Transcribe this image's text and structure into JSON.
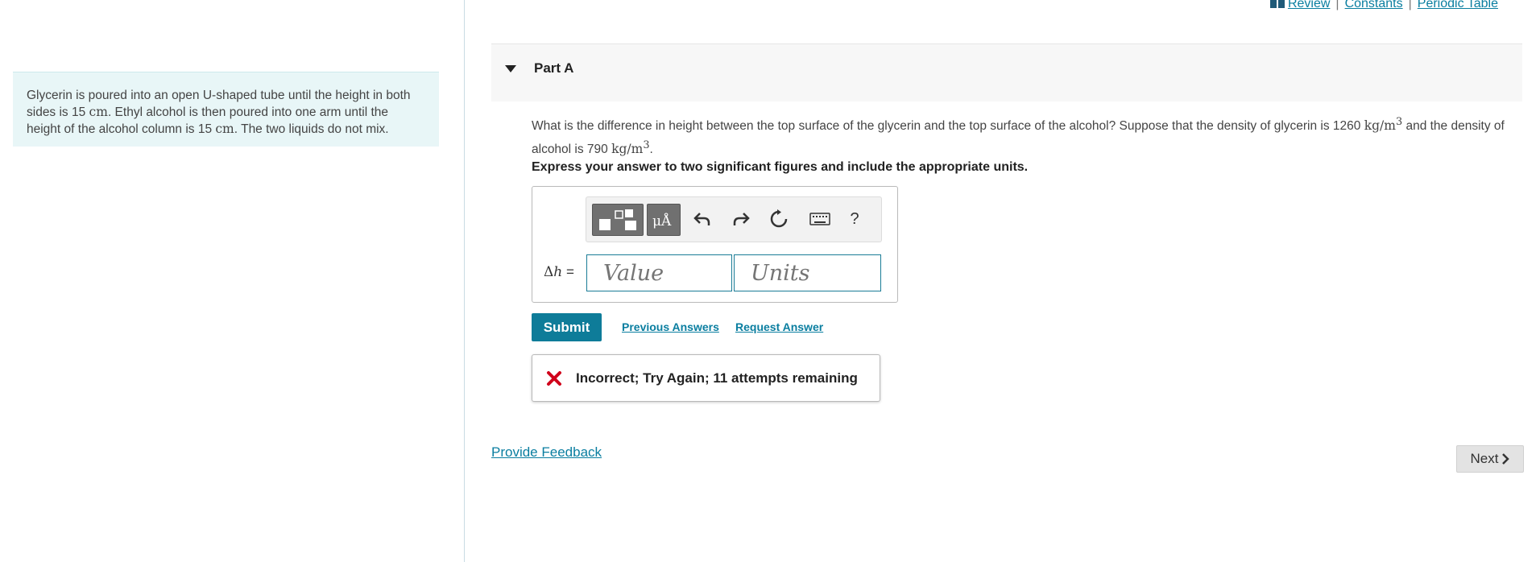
{
  "intro": {
    "t1": "Glycerin is poured into an open U-shaped tube until the height in both sides is 15 ",
    "u1": "cm",
    "t2": ". Ethyl alcohol is then poured into one arm until the height of the alcohol column is 15 ",
    "u2": "cm",
    "t3": ". The two liquids do not mix."
  },
  "toplinks": {
    "review": "Review",
    "constants": "Constants",
    "periodic": "Periodic Table",
    "sep": "|"
  },
  "part": {
    "title": "Part A"
  },
  "question": {
    "t1": "What is the difference in height between the top surface of the glycerin and the top surface of the alcohol? Suppose that the density of glycerin is 1260 ",
    "unit": "kg/m",
    "exp": "3",
    "t2": " and the density of alcohol is 790 ",
    "t3": "."
  },
  "instruction": "Express your answer to two significant figures and include the appropriate units.",
  "toolbar": {
    "units_glyph": "μÅ",
    "help": "?"
  },
  "answer": {
    "label_sym": "Δ",
    "label_var": "h",
    "label_eq": " =",
    "value_placeholder": "Value",
    "units_placeholder": "Units"
  },
  "actions": {
    "submit": "Submit",
    "previous": "Previous Answers",
    "request": "Request Answer"
  },
  "feedback": {
    "text": "Incorrect; Try Again; 11 attempts remaining"
  },
  "footer": {
    "provide_feedback": "Provide Feedback",
    "next": "Next"
  },
  "colors": {
    "accent": "#0e7c99",
    "error": "#d0021b",
    "intro_bg": "#e8f6f7"
  }
}
